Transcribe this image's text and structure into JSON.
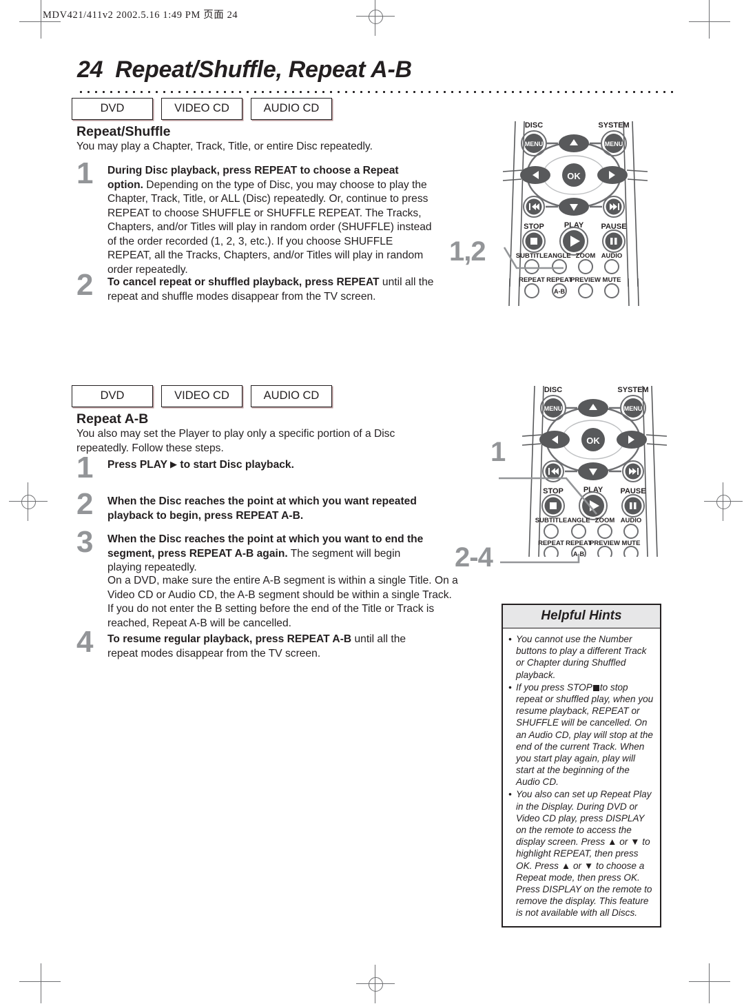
{
  "header": {
    "print_line": "MDV421/411v2  2002.5.16  1:49 PM  页面 24"
  },
  "title": {
    "page_number": "24",
    "text": "Repeat/Shuffle, Repeat A-B"
  },
  "badges": {
    "dvd": "DVD",
    "video_cd": "VIDEO CD",
    "audio_cd": "AUDIO CD"
  },
  "section1": {
    "heading": "Repeat/Shuffle",
    "intro": "You may play a Chapter, Track, Title, or entire Disc repeatedly.",
    "steps": [
      {
        "number": "1",
        "bold": "During Disc playback, press REPEAT to choose a Repeat option.",
        "rest": " Depending on the type of Disc, you may choose to play the Chapter, Track, Title, or ALL (Disc) repeatedly. Or, continue to press REPEAT to choose SHUFFLE or SHUFFLE REPEAT. The Tracks, Chapters, and/or Titles will play in random order (SHUFFLE) instead of the order recorded (1, 2, 3, etc.). If you choose SHUFFLE REPEAT, all the Tracks, Chapters, and/or Titles will play in random order repeatedly."
      },
      {
        "number": "2",
        "bold": "To cancel repeat or shuffled playback, press REPEAT",
        "rest": " until all the repeat and shuffle modes disappear from the TV screen."
      }
    ]
  },
  "section2": {
    "heading": "Repeat A-B",
    "intro": "You also may set the Player to play only a specific portion of a Disc repeatedly. Follow these steps.",
    "steps": [
      {
        "number": "1",
        "bold_pre": "Press PLAY",
        "bold_post": "to start Disc playback.",
        "rest": ""
      },
      {
        "number": "2",
        "bold": "When the Disc reaches the point at which you want repeated playback to begin, press REPEAT A-B.",
        "rest": ""
      },
      {
        "number": "3",
        "bold": "When the Disc reaches the point at which you want to end the segment, press REPEAT A-B again.",
        "rest": " The segment will begin playing repeatedly."
      },
      {
        "number": "4",
        "bold": "To resume regular playback, press REPEAT A-B",
        "rest": " until all the repeat modes disappear from the TV screen."
      }
    ],
    "note": "On a DVD, make sure the entire A-B segment is within a single Title. On a Video CD or Audio CD, the A-B segment should be within a single Track. If you do not enter the B setting before the end of the Title or Track is reached, Repeat A-B will be cancelled."
  },
  "hints": {
    "title": "Helpful Hints",
    "items": [
      {
        "pre": "You cannot use the Number buttons to play a different Track or Chapter during Shuffled playback.",
        "has_stop_icon": false,
        "post": ""
      },
      {
        "pre": "If you press STOP",
        "has_stop_icon": true,
        "post": "to stop repeat or shuffled play, when you resume playback, REPEAT or SHUFFLE will be cancelled. On an Audio CD, play will stop at the end of the current Track. When you start play again, play will start at the beginning of the Audio CD."
      },
      {
        "pre": "You also can set up Repeat Play in the Display. During DVD or Video CD play, press DISPLAY on the remote to access the display screen. Press ▲ or ▼  to highlight REPEAT, then press OK. Press ▲ or ▼ to choose a Repeat mode, then press OK. Press DISPLAY on the remote to remove the display. This feature is not available with all Discs.",
        "has_stop_icon": false,
        "post": ""
      }
    ]
  },
  "remote": {
    "labels": {
      "disc": "DISC",
      "system": "SYSTEM",
      "menu": "MENU",
      "ok": "OK",
      "stop": "STOP",
      "play": "PLAY",
      "pause": "PAUSE",
      "subtitle": "SUBTITLE",
      "angle": "ANGLE",
      "zoom": "ZOOM",
      "audio": "AUDIO",
      "repeat": "REPEAT",
      "repeat_ab": "REPEAT",
      "ab": "A-B",
      "preview": "PREVIEW",
      "mute": "MUTE"
    },
    "callout_top": "1,2",
    "callout_mid": "1",
    "callout_bottom": "2-4"
  },
  "colors": {
    "ink": "#231f20",
    "gray_number": "#939598",
    "badge_shadow": "#b9989a",
    "hint_header_bg": "#e7e7e8",
    "mark": "#6d6e71"
  }
}
